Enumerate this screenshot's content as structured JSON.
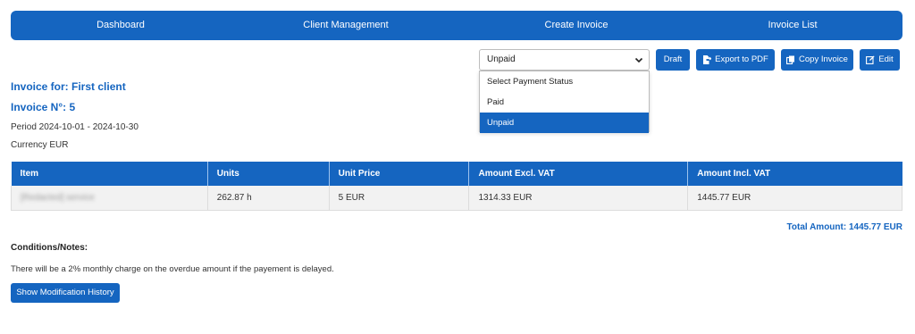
{
  "nav": {
    "items": [
      {
        "label": "Dashboard"
      },
      {
        "label": "Client Management"
      },
      {
        "label": "Create Invoice"
      },
      {
        "label": "Invoice List"
      }
    ]
  },
  "status_select": {
    "value": "Unpaid",
    "options": [
      "Select Payment Status",
      "Paid",
      "Unpaid"
    ],
    "selected_index": 2
  },
  "toolbar": {
    "draft_label": "Draft",
    "export_label": "Export to PDF",
    "copy_label": "Copy Invoice",
    "edit_label": "Edit"
  },
  "invoice": {
    "for_label": "Invoice for: First client",
    "number_label": "Invoice N°: 5",
    "period": "Period 2024-10-01 - 2024-10-30",
    "currency": "Currency EUR"
  },
  "table": {
    "headers": [
      "Item",
      "Units",
      "Unit Price",
      "Amount Excl. VAT",
      "Amount Incl. VAT"
    ],
    "rows": [
      [
        "[Redacted] service",
        "262.87 h",
        "5 EUR",
        "1314.33 EUR",
        "1445.77 EUR"
      ]
    ]
  },
  "total_amount": "Total Amount: 1445.77 EUR",
  "notes": {
    "heading": "Conditions/Notes:",
    "text": "There will be a 2% monthly charge on the overdue amount if the payement is delayed."
  },
  "history_button_label": "Show Modification History",
  "colors": {
    "accent": "#1565c0",
    "table_row_bg": "#f2f2f2"
  }
}
